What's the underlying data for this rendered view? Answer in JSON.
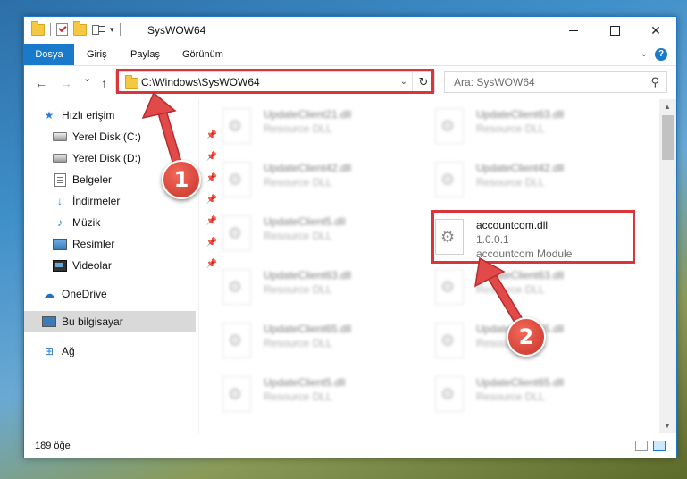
{
  "window": {
    "title": "SysWOW64",
    "controls": {
      "minimize": "",
      "maximize": "",
      "close": "✕"
    }
  },
  "ribbon": {
    "tabs": [
      {
        "label": "Dosya",
        "active": true
      },
      {
        "label": "Giriş",
        "active": false
      },
      {
        "label": "Paylaş",
        "active": false
      },
      {
        "label": "Görünüm",
        "active": false
      }
    ],
    "help": "?"
  },
  "nav": {
    "back": "←",
    "forward": "→",
    "recent": "⌄",
    "up": "↑",
    "address": "C:\\Windows\\SysWOW64",
    "address_dropdown": "⌄",
    "refresh": "↻",
    "search_placeholder": "Ara: SysWOW64",
    "search_icon": "⚲"
  },
  "sidebar": {
    "items": [
      {
        "label": "Hızlı erişim",
        "icon": "star-icon",
        "pinned": false
      },
      {
        "label": "Yerel Disk (C:)",
        "icon": "drive-icon",
        "pinned": true
      },
      {
        "label": "Yerel Disk (D:)",
        "icon": "drive-icon",
        "pinned": true
      },
      {
        "label": "Belgeler",
        "icon": "documents-icon",
        "pinned": true
      },
      {
        "label": "İndirmeler",
        "icon": "downloads-icon",
        "pinned": true
      },
      {
        "label": "Müzik",
        "icon": "music-icon",
        "pinned": true
      },
      {
        "label": "Resimler",
        "icon": "pictures-icon",
        "pinned": true
      },
      {
        "label": "Videolar",
        "icon": "videos-icon",
        "pinned": true
      },
      {
        "label": "OneDrive",
        "icon": "onedrive-icon",
        "pinned": false
      },
      {
        "label": "Bu bilgisayar",
        "icon": "computer-icon",
        "pinned": false,
        "selected": true
      },
      {
        "label": "Ağ",
        "icon": "network-icon",
        "pinned": false
      }
    ]
  },
  "files": {
    "col1": [
      {
        "name": "UpdateClient21.dll",
        "type": "Resource DLL"
      },
      {
        "name": "UpdateClient42.dll",
        "type": "Resource DLL"
      },
      {
        "name": "UpdateClient5.dll",
        "type": "Resource DLL"
      },
      {
        "name": "UpdateClient63.dll",
        "type": "Resource DLL"
      },
      {
        "name": "UpdateClient65.dll",
        "type": "Resource DLL"
      },
      {
        "name": "UpdateClient5.dll",
        "type": "Resource DLL"
      }
    ],
    "col2": [
      {
        "name": "UpdateClient63.dll",
        "type": "Resource DLL"
      },
      {
        "name": "UpdateClient42.dll",
        "type": "Resource DLL"
      },
      {
        "name": "UpdateClient63.dll",
        "type": "Resource DLL"
      },
      {
        "name": "UpdateClient65.dll",
        "type": "Resource DLL"
      },
      {
        "name": "UpdateClient65.dll",
        "type": "Resource DLL"
      }
    ],
    "highlighted": {
      "name": "accountcom.dll",
      "version": "1.0.0.1",
      "description": "accountcom Module"
    }
  },
  "status": {
    "count": "189 öğe"
  },
  "annotations": {
    "badge1": "1",
    "badge2": "2",
    "color": "#d9353a"
  }
}
